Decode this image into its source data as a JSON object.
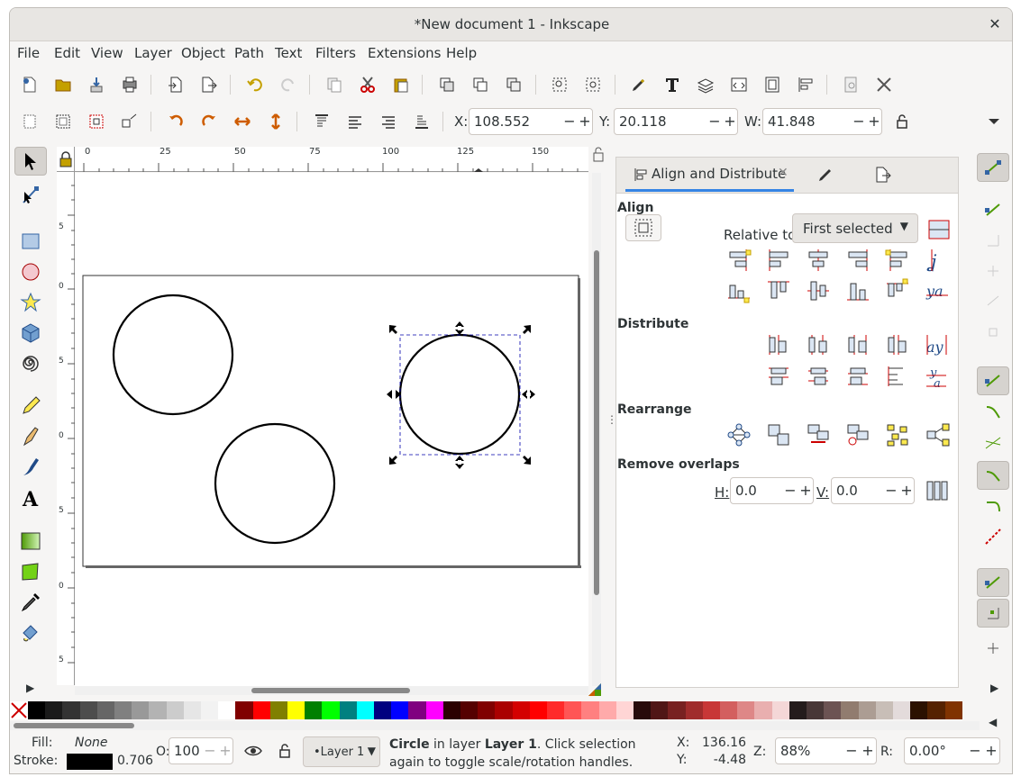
{
  "window": {
    "title": "*New document 1 - Inkscape",
    "close": "✕"
  },
  "menu": [
    "File",
    "Edit",
    "View",
    "Layer",
    "Object",
    "Path",
    "Text",
    "Filters",
    "Extensions",
    "Help"
  ],
  "toolcontrols": {
    "x_label": "X:",
    "x": "108.552",
    "y_label": "Y:",
    "y": "20.118",
    "w_label": "W:",
    "w": "41.848"
  },
  "ruler": {
    "top": [
      "0",
      "25",
      "50",
      "75",
      "100",
      "125",
      "150"
    ],
    "left": [
      "5",
      "0",
      "5",
      "0",
      "5",
      "0",
      "5",
      "0",
      "5",
      "0"
    ]
  },
  "dock": {
    "tab_label": "Align and Distribute",
    "align_title": "Align",
    "relative_label": "Relative to:",
    "relative_value": "First selected",
    "distribute_title": "Distribute",
    "rearrange_title": "Rearrange",
    "overlaps_title": "Remove overlaps",
    "h_label": "H:",
    "h_value": "0.0",
    "v_label": "V:",
    "v_value": "0.0"
  },
  "status": {
    "fill_label": "Fill:",
    "fill_value": "None",
    "stroke_label": "Stroke:",
    "stroke_width": "0.706",
    "opacity_label": "O:",
    "opacity": "100",
    "layer": "•Layer 1",
    "msg_bold1": "Circle",
    "msg_mid": " in layer ",
    "msg_bold2": "Layer 1",
    "msg_tail": ". Click selection again to toggle scale/rotation handles.",
    "cx_label": "X:",
    "cx": "136.16",
    "cy_label": "Y:",
    "cy": "-4.48",
    "zoom_label": "Z:",
    "zoom": "88%",
    "rot_label": "R:",
    "rot": "0.00°"
  },
  "palette": [
    "#000000",
    "#1a1a1a",
    "#333333",
    "#4d4d4d",
    "#666666",
    "#808080",
    "#999999",
    "#b3b3b3",
    "#cccccc",
    "#e6e6e6",
    "#f2f2f2",
    "#ffffff",
    "#800000",
    "#ff0000",
    "#808000",
    "#ffff00",
    "#008000",
    "#00ff00",
    "#008080",
    "#00ffff",
    "#000080",
    "#0000ff",
    "#800080",
    "#ff00ff",
    "#2b0000",
    "#550000",
    "#800000",
    "#aa0000",
    "#d40000",
    "#ff0000",
    "#ff2a2a",
    "#ff5555",
    "#ff8080",
    "#ffaaaa",
    "#ffd5d5",
    "#280b0b",
    "#501616",
    "#782121",
    "#a02c2c",
    "#c83737",
    "#d35f5f",
    "#de8787",
    "#e9afaf",
    "#f4d7d7",
    "#241c1c",
    "#483737",
    "#6c5353",
    "#917c6f",
    "#ac9d93",
    "#c8beb7",
    "#e3dbdb",
    "#2b1100",
    "#552200",
    "#803300"
  ]
}
